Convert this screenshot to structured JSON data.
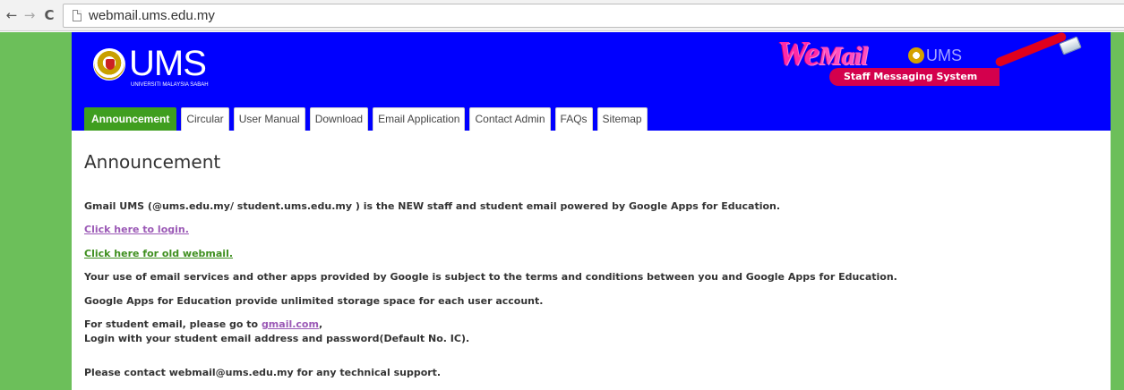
{
  "browser": {
    "back_icon": "←",
    "forward_icon": "→",
    "reload_icon": "C",
    "url": "webmail.ums.edu.my"
  },
  "header": {
    "logo_text": "UMS",
    "logo_subtext": "UNIVERSITI MALAYSIA SABAH",
    "webmail_logo_main": "We",
    "webmail_logo_mail": "Mail",
    "webmail_logo_ums": "UMS",
    "webmail_tagline": "Staff Messaging System",
    "colors": {
      "header_bg": "#0000ff",
      "active_tab": "#3f9e1f",
      "page_bg": "#6cbf5a"
    }
  },
  "tabs": [
    {
      "label": "Announcement",
      "active": true
    },
    {
      "label": "Circular",
      "active": false
    },
    {
      "label": "User Manual",
      "active": false
    },
    {
      "label": "Download",
      "active": false
    },
    {
      "label": "Email Application",
      "active": false
    },
    {
      "label": "Contact Admin",
      "active": false
    },
    {
      "label": "FAQs",
      "active": false
    },
    {
      "label": "Sitemap",
      "active": false
    }
  ],
  "content": {
    "title": "Announcement",
    "intro": "Gmail UMS (@ums.edu.my/ student.ums.edu.my ) is the NEW staff and student email powered by Google Apps for Education.",
    "login_link": "Click here to login.",
    "old_webmail_link": "Click here for old webmail.",
    "terms": "Your use of email services and other apps provided by Google is subject to the terms and conditions between you and Google Apps for Education.",
    "storage": "Google Apps for Education provide unlimited storage space for each user account.",
    "student_prefix": "For student email, please go to ",
    "student_link": "gmail.com",
    "student_suffix": ",",
    "student_login": "Login with your student email address and password(Default No. IC).",
    "support": "Please contact webmail@ums.edu.my for any technical support."
  }
}
